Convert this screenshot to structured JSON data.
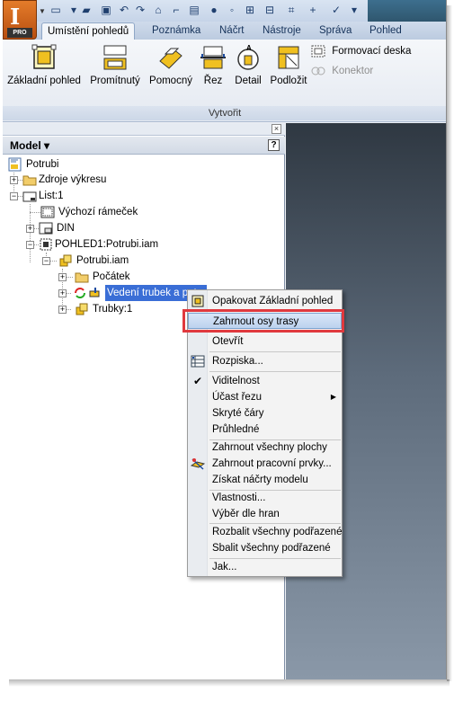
{
  "app": {
    "badge": "PRO"
  },
  "tabs": [
    "Umístění pohledů",
    "Poznámka",
    "Náčrt",
    "Nástroje",
    "Správa",
    "Pohled"
  ],
  "ribbon": {
    "buttons": [
      "Základní pohled",
      "Promítnutý",
      "Pomocný",
      "Řez",
      "Detail",
      "Podložit"
    ],
    "small_buttons": [
      "Formovací deska",
      "Konektor"
    ],
    "group_label": "Vytvořit"
  },
  "browser": {
    "title": "Model",
    "help": "?",
    "close": "×",
    "nodes": [
      "Potrubi",
      "Zdroje výkresu",
      "List:1",
      "Výchozí rámeček",
      "DIN",
      "POHLED1:Potrubi.iam",
      "Potrubi.iam",
      "Počátek",
      "Vedení trubek a pot...",
      "Trubky:1"
    ]
  },
  "menu": {
    "items": [
      "Opakovat Základní pohled",
      "Zahrnout osy trasy",
      "Otevřít",
      "Rozpiska...",
      "Viditelnost",
      "Účast řezu",
      "Skryté čáry",
      "Průhledné",
      "Zahrnout všechny plochy",
      "Zahrnout pracovní prvky...",
      "Získat náčrty modelu",
      "Vlastnosti...",
      "Výběr dle hran",
      "Rozbalit všechny podřazené",
      "Sbalit všechny podřazené",
      "Jak..."
    ],
    "highlighted": "Zahrnout osy trasy",
    "highlight_color": "#e0393e"
  },
  "colors": {
    "accent": "#3a6ed6",
    "app_button": "#d2651d"
  }
}
